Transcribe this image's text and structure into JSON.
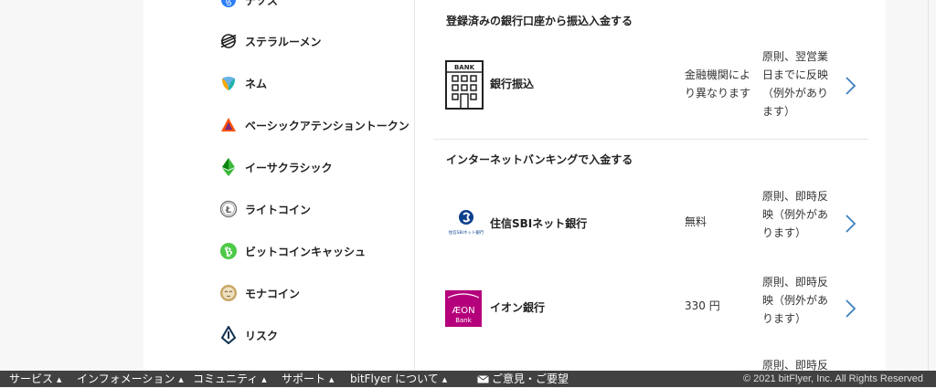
{
  "sidebar": {
    "items": [
      {
        "label": "テゾス",
        "icon": "tezos-icon"
      },
      {
        "label": "ステラルーメン",
        "icon": "stellar-icon"
      },
      {
        "label": "ネム",
        "icon": "nem-icon"
      },
      {
        "label": "ベーシックアテンショントークン",
        "icon": "bat-icon"
      },
      {
        "label": "イーサクラシック",
        "icon": "ethereum-classic-icon"
      },
      {
        "label": "ライトコイン",
        "icon": "litecoin-icon"
      },
      {
        "label": "ビットコインキャッシュ",
        "icon": "bitcoin-cash-icon"
      },
      {
        "label": "モナコイン",
        "icon": "monacoin-icon"
      },
      {
        "label": "リスク",
        "icon": "lisk-icon"
      }
    ]
  },
  "sections": [
    {
      "title": "登録済みの銀行口座から振込入金する",
      "rows": [
        {
          "name": "銀行振込",
          "logo": "bank-building-icon",
          "logo_text": "BANK",
          "fee": "金融機関により異なります",
          "timing": "原則、翌営業日までに反映（例外があります）"
        }
      ]
    },
    {
      "title": "インターネットバンキングで入金する",
      "rows": [
        {
          "name": "住信SBIネット銀行",
          "logo": "sbi-logo",
          "logo_text": "住信SBIネット銀行",
          "fee": "無料",
          "timing": "原則、即時反映（例外があります）"
        },
        {
          "name": "イオン銀行",
          "logo": "aeon-logo",
          "logo_text": "ÆON",
          "logo_subtext": "Bank",
          "fee": "330 円",
          "timing": "原則、即時反映（例外があります）"
        },
        {
          "name": "",
          "logo": "",
          "fee": "",
          "timing": "原則、即時反"
        }
      ]
    }
  ],
  "footer": {
    "nav": [
      "サービス",
      "インフォメーション",
      "コミュニティ",
      "サポート",
      "bitFlyer について"
    ],
    "feedback": "ご意見・ご要望",
    "copyright": "© 2021 bitFlyer, Inc. All Rights Reserved"
  },
  "colors": {
    "accent": "#3d7fbf",
    "footer_bg": "#414141"
  }
}
